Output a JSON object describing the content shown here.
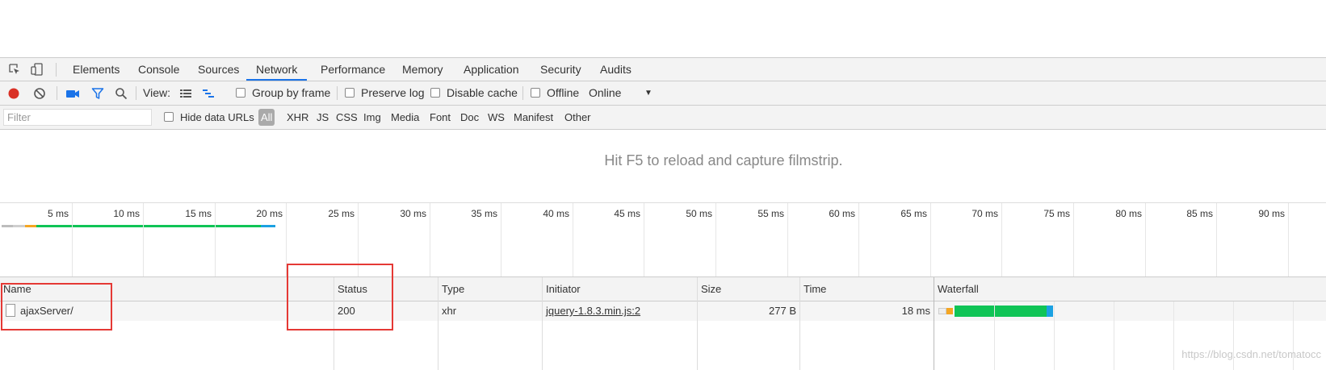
{
  "tabs": [
    {
      "label": "Elements"
    },
    {
      "label": "Console"
    },
    {
      "label": "Sources"
    },
    {
      "label": "Network",
      "active": true
    },
    {
      "label": "Performance"
    },
    {
      "label": "Memory"
    },
    {
      "label": "Application"
    },
    {
      "label": "Security"
    },
    {
      "label": "Audits"
    }
  ],
  "toolbar": {
    "view_label": "View:",
    "group_by_frame": "Group by frame",
    "preserve_log": "Preserve log",
    "disable_cache": "Disable cache",
    "offline": "Offline",
    "throttle_value": "Online",
    "record_color": "#d93025",
    "accent_color": "#1a73e8"
  },
  "filter": {
    "placeholder": "Filter",
    "hide_data_urls": "Hide data URLs",
    "types": [
      "All",
      "XHR",
      "JS",
      "CSS",
      "Img",
      "Media",
      "Font",
      "Doc",
      "WS",
      "Manifest",
      "Other"
    ],
    "active_type": "All"
  },
  "filmstrip_message": "Hit F5 to reload and capture filmstrip.",
  "overview": {
    "ticks": [
      "5 ms",
      "10 ms",
      "15 ms",
      "20 ms",
      "25 ms",
      "30 ms",
      "35 ms",
      "40 ms",
      "45 ms",
      "50 ms",
      "55 ms",
      "60 ms",
      "65 ms",
      "70 ms",
      "75 ms",
      "80 ms",
      "85 ms",
      "90 ms"
    ],
    "waiting_color": "#bdbdbd",
    "stalled_color": "#f5a623",
    "ttfb_color": "#0fc456",
    "download_color": "#1ba1e2"
  },
  "table": {
    "columns": [
      "Name",
      "Status",
      "Type",
      "Initiator",
      "Size",
      "Time",
      "Waterfall"
    ],
    "rows": [
      {
        "name": "ajaxServer/",
        "status": "200",
        "type": "xhr",
        "initiator": "jquery-1.8.3.min.js:2",
        "size": "277 B",
        "time": "18 ms"
      }
    ]
  },
  "watermark": "https://blog.csdn.net/tomatocc",
  "highlight_color": "#e53935"
}
